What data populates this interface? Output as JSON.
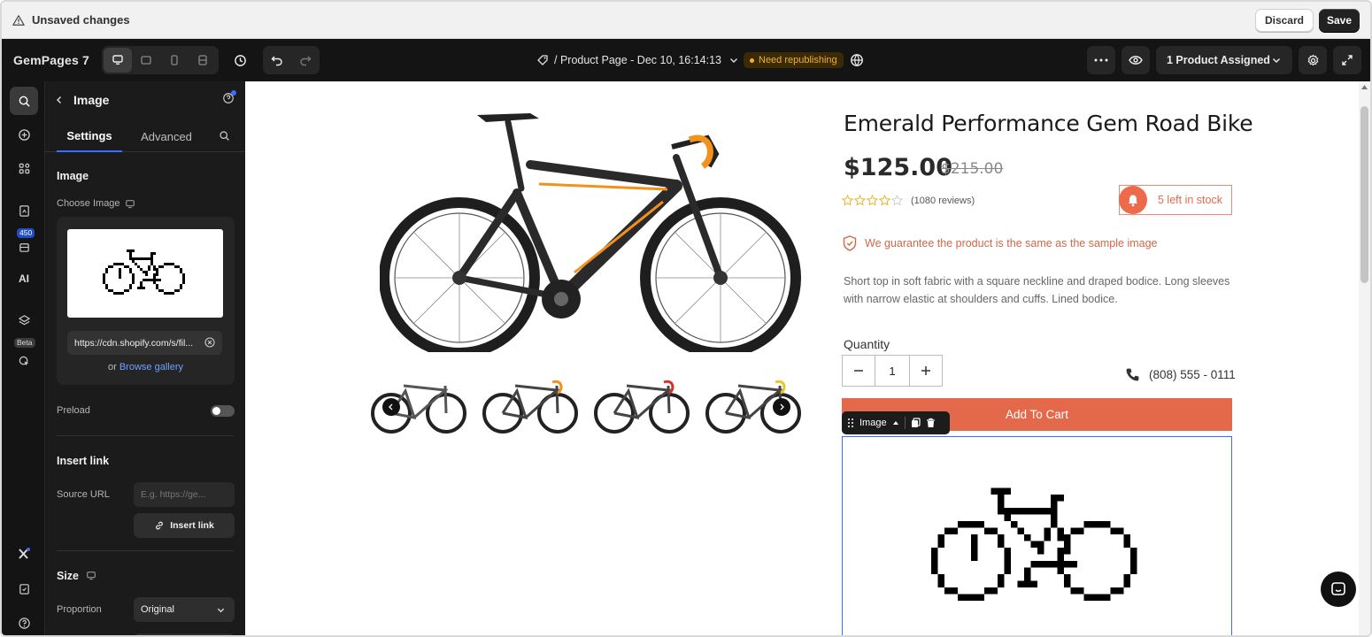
{
  "unsaved_bar": {
    "message": "Unsaved changes",
    "discard": "Discard",
    "save": "Save"
  },
  "topbar": {
    "brand": "GemPages 7",
    "page_title": "/ Product Page - Dec 10, 16:14:13",
    "republish_badge": "Need republishing",
    "assign_label": "1 Product Assigned"
  },
  "rail": {
    "badge_count": "450",
    "beta_label": "Beta",
    "ai_label": "AI"
  },
  "panel": {
    "title": "Image",
    "tabs": [
      "Settings",
      "Advanced"
    ],
    "image_section": "Image",
    "choose_image": "Choose Image",
    "image_url": "https://cdn.shopify.com/s/fil...",
    "or_text": "or",
    "browse_gallery": "Browse gallery",
    "preload": "Preload",
    "insert_link_section": "Insert link",
    "source_url": "Source URL",
    "source_placeholder": "E.g. https://ge...",
    "insert_link_button": "Insert link",
    "size_section": "Size",
    "proportion": "Proportion",
    "proportion_value": "Original"
  },
  "product": {
    "title": "Emerald Performance Gem Road Bike",
    "price": "$125.00",
    "compare_price": "$215.00",
    "rating": 0,
    "reviews": "(1080 reviews)",
    "stock": "5 left in stock",
    "guarantee": "We guarantee the product is the same as the sample image",
    "description": "Short top in soft fabric with a square neckline and draped bodice. Long sleeves with narrow elastic at shoulders and cuffs. Lined bodice.",
    "quantity_label": "Quantity",
    "quantity_value": "1",
    "phone": "(808) 555 - 0111",
    "add_to_cart": "Add To Cart",
    "image_toolbar_label": "Image"
  },
  "colors": {
    "accent": "#e4694b",
    "selection": "#3b6cff",
    "dark": "#141414",
    "warning": "#f1b12e"
  }
}
